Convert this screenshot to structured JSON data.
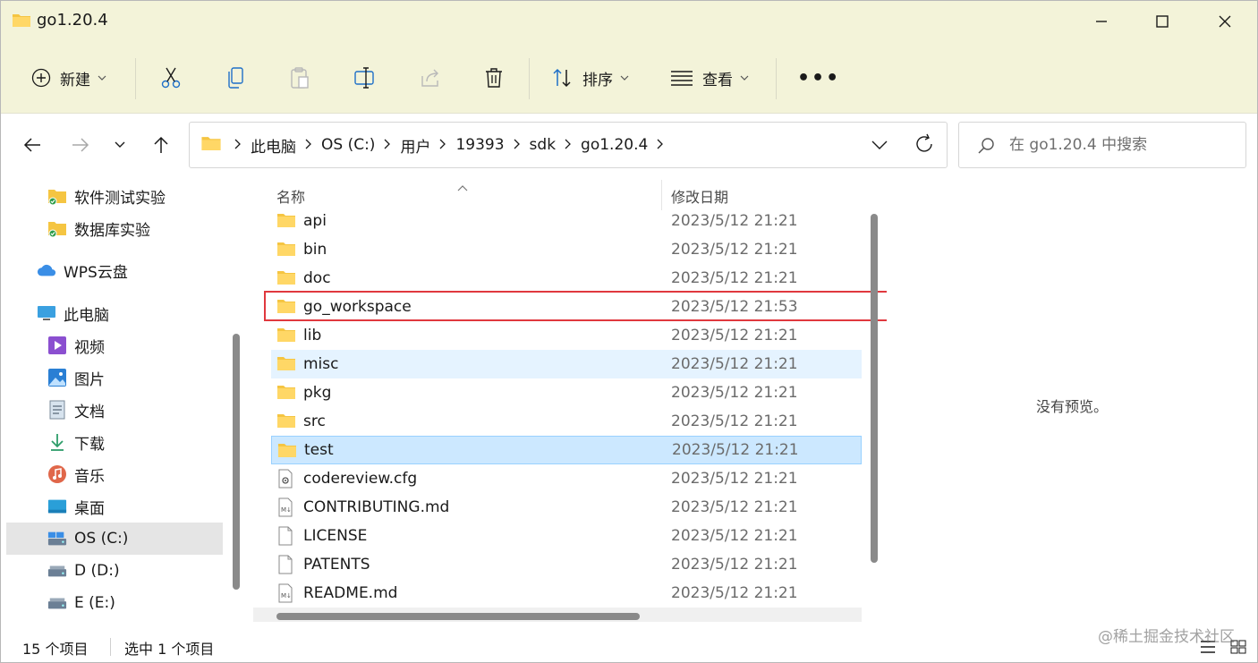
{
  "window": {
    "title": "go1.20.4"
  },
  "toolbar": {
    "new_label": "新建",
    "sort_label": "排序",
    "view_label": "查看",
    "more_label": "•••"
  },
  "address": {
    "crumbs": [
      "此电脑",
      "OS (C:)",
      "用户",
      "19393",
      "sdk",
      "go1.20.4"
    ]
  },
  "search": {
    "placeholder": "在 go1.20.4 中搜索"
  },
  "sidebar": {
    "items": [
      {
        "label": "软件测试实验",
        "icon": "folder-synced-icon"
      },
      {
        "label": "数据库实验",
        "icon": "folder-synced-icon"
      },
      {
        "label": "WPS云盘",
        "icon": "cloud-icon"
      },
      {
        "label": "此电脑",
        "icon": "computer-icon"
      },
      {
        "label": "视频",
        "icon": "video-icon"
      },
      {
        "label": "图片",
        "icon": "picture-icon"
      },
      {
        "label": "文档",
        "icon": "document-icon"
      },
      {
        "label": "下载",
        "icon": "download-icon"
      },
      {
        "label": "音乐",
        "icon": "music-icon"
      },
      {
        "label": "桌面",
        "icon": "desktop-icon"
      },
      {
        "label": "OS (C:)",
        "icon": "drive-icon"
      },
      {
        "label": "D (D:)",
        "icon": "drive-icon"
      },
      {
        "label": "E (E:)",
        "icon": "drive-icon"
      }
    ]
  },
  "columns": {
    "name": "名称",
    "modified": "修改日期"
  },
  "files": [
    {
      "name": "api",
      "date": "2023/5/12 21:21",
      "type": "folder"
    },
    {
      "name": "bin",
      "date": "2023/5/12 21:21",
      "type": "folder"
    },
    {
      "name": "doc",
      "date": "2023/5/12 21:21",
      "type": "folder"
    },
    {
      "name": "go_workspace",
      "date": "2023/5/12 21:53",
      "type": "folder"
    },
    {
      "name": "lib",
      "date": "2023/5/12 21:21",
      "type": "folder"
    },
    {
      "name": "misc",
      "date": "2023/5/12 21:21",
      "type": "folder"
    },
    {
      "name": "pkg",
      "date": "2023/5/12 21:21",
      "type": "folder"
    },
    {
      "name": "src",
      "date": "2023/5/12 21:21",
      "type": "folder"
    },
    {
      "name": "test",
      "date": "2023/5/12 21:21",
      "type": "folder"
    },
    {
      "name": "codereview.cfg",
      "date": "2023/5/12 21:21",
      "type": "config"
    },
    {
      "name": "CONTRIBUTING.md",
      "date": "2023/5/12 21:21",
      "type": "markdown"
    },
    {
      "name": "LICENSE",
      "date": "2023/5/12 21:21",
      "type": "file"
    },
    {
      "name": "PATENTS",
      "date": "2023/5/12 21:21",
      "type": "file"
    },
    {
      "name": "README.md",
      "date": "2023/5/12 21:21",
      "type": "markdown"
    }
  ],
  "preview": {
    "empty_text": "没有预览。"
  },
  "status": {
    "item_count": "15 个项目",
    "selected_count": "选中 1 个项目"
  },
  "watermark": "@稀土掘金技术社区",
  "colors": {
    "chrome_bg": "#f3f3d9",
    "folder": "#f5c542",
    "selection": "#cce8ff",
    "hover": "#e5f3ff",
    "highlight": "#e0383e"
  }
}
